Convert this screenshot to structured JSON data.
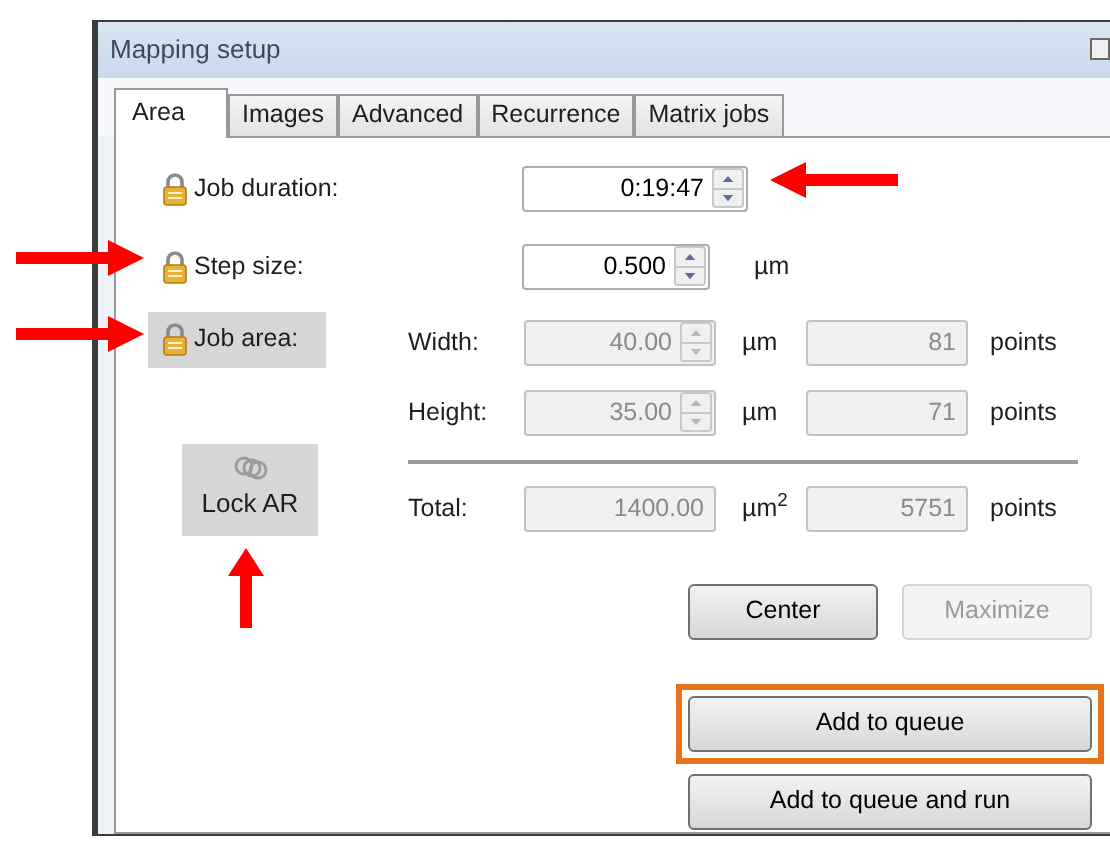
{
  "window": {
    "title": "Mapping setup"
  },
  "tabs": [
    {
      "label": "Area",
      "selected": true
    },
    {
      "label": "Images",
      "selected": false
    },
    {
      "label": "Advanced",
      "selected": false
    },
    {
      "label": "Recurrence",
      "selected": false
    },
    {
      "label": "Matrix jobs",
      "selected": false
    }
  ],
  "job_duration": {
    "label": "Job duration:",
    "value": "0:19:47",
    "pressed": false
  },
  "step_size": {
    "label": "Step size:",
    "value": "0.500",
    "unit": "µm",
    "pressed": false
  },
  "job_area": {
    "label": "Job area:",
    "pressed": true
  },
  "area_rows": [
    {
      "label": "Width:",
      "value": "40.00",
      "unit": "µm",
      "points": "81",
      "points_unit": "points",
      "spin": true,
      "disabled": true
    },
    {
      "label": "Height:",
      "value": "35.00",
      "unit": "µm",
      "points": "71",
      "points_unit": "points",
      "spin": true,
      "disabled": true
    },
    {
      "label": "Total:",
      "value": "1400.00",
      "unit": "µm$^{2}$",
      "points": "5751",
      "points_unit": "points",
      "spin": false,
      "disabled": true
    }
  ],
  "lock_ar": {
    "label": "Lock AR",
    "pressed": true
  },
  "buttons": [
    {
      "label": "Center",
      "disabled": false
    },
    {
      "label": "Maximize",
      "disabled": true
    }
  ],
  "queue_buttons": [
    {
      "label": "Add to queue",
      "highlighted": true
    },
    {
      "label": "Add to queue and run",
      "highlighted": false
    }
  ],
  "annotations": [
    {
      "kind": "left"
    },
    {
      "kind": "right"
    },
    {
      "kind": "right"
    },
    {
      "kind": "up"
    }
  ]
}
